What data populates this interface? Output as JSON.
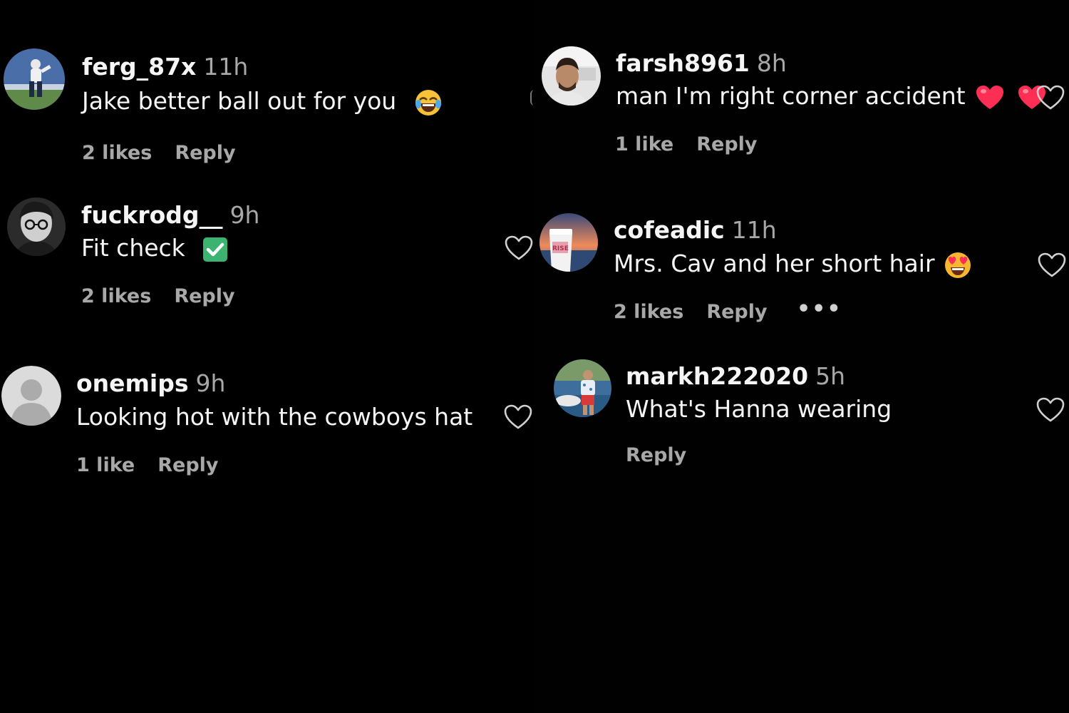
{
  "left_comments": [
    {
      "user": "ferg_87x",
      "time": "11h",
      "text": "Jake better ball out for you",
      "emoji": "laughing-emoji",
      "likes": "2 likes",
      "reply": "Reply"
    },
    {
      "user": "fuckrodg__",
      "time": "9h",
      "text": "Fit check",
      "emoji": "check-mark-emoji",
      "likes": "2 likes",
      "reply": "Reply"
    },
    {
      "user": "onemips",
      "time": "9h",
      "text": "Looking hot with the cowboys hat",
      "likes": "1 like",
      "reply": "Reply"
    }
  ],
  "right_comments": [
    {
      "user": "farsh8961",
      "time": "8h",
      "text": "man I'm right corner accident",
      "emoji": "red-heart-emoji",
      "likes": "1 like",
      "reply": "Reply"
    },
    {
      "user": "cofeadic",
      "time": "11h",
      "text": "Mrs. Cav and her short hair",
      "emoji": "heart-eyes-emoji",
      "likes": "2 likes",
      "reply": "Reply",
      "more": "•••"
    },
    {
      "user": "markh222020",
      "time": "5h",
      "text": "What's Hanna wearing",
      "reply": "Reply"
    }
  ],
  "colors": {
    "background": "#000000",
    "text": "#f5f5f5",
    "secondary": "#a8a8a8",
    "heart_outline": "#d0d0d0",
    "check_green": "#3cb371",
    "heart_red": "#ff2e55"
  }
}
